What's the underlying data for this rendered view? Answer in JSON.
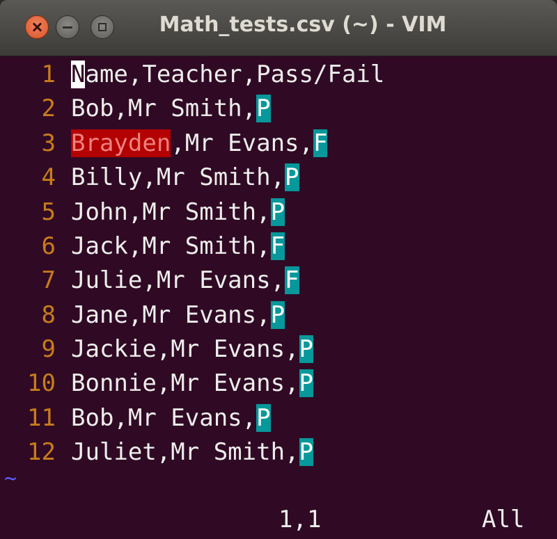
{
  "window": {
    "title": "Math_tests.csv (~) - VIM"
  },
  "editor": {
    "lines": [
      {
        "num": "1",
        "cursor": "N",
        "text": "ame,Teacher,Pass/Fail"
      },
      {
        "num": "2",
        "text": "Bob,Mr Smith,",
        "mark": "P"
      },
      {
        "num": "3",
        "err": "Brayden",
        "text": ",Mr Evans,",
        "mark": "F"
      },
      {
        "num": "4",
        "text": "Billy,Mr Smith,",
        "mark": "P"
      },
      {
        "num": "5",
        "text": "John,Mr Smith,",
        "mark": "P"
      },
      {
        "num": "6",
        "text": "Jack,Mr Smith,",
        "mark": "F"
      },
      {
        "num": "7",
        "text": "Julie,Mr Evans,",
        "mark": "F"
      },
      {
        "num": "8",
        "text": "Jane,Mr Evans,",
        "mark": "P"
      },
      {
        "num": "9",
        "text": "Jackie,Mr Evans,",
        "mark": "P"
      },
      {
        "num": "10",
        "text": "Bonnie,Mr Evans,",
        "mark": "P"
      },
      {
        "num": "11",
        "text": "Bob,Mr Evans,",
        "mark": "P"
      },
      {
        "num": "12",
        "text": "Juliet,Mr Smith,",
        "mark": "P"
      }
    ],
    "empty_marker": "~"
  },
  "status": {
    "position": "1,1",
    "scroll": "All"
  },
  "colors": {
    "background": "#300a24",
    "line_number": "#c87d1a",
    "highlight": "#06989a",
    "error": "#b30000",
    "tilde": "#5d5dff"
  }
}
